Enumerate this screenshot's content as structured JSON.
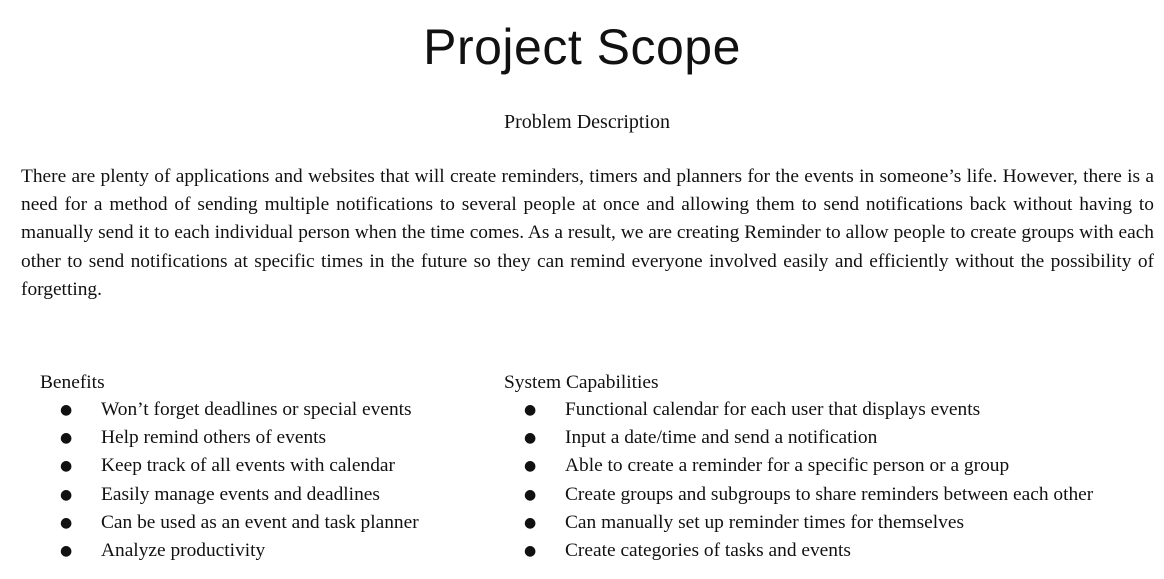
{
  "document": {
    "title": "Project Scope",
    "subtitle": "Problem Description",
    "paragraph": "There are plenty of applications and websites that will create reminders, timers and planners for the events in someone’s life. However, there is a need for a method of sending multiple notifications to several people at once and allowing them to send notifications back without having to manually send it to each individual person when the time comes. As a result, we are creating Reminder to allow people to create groups with each other to send notifications at specific times in the future so they can remind everyone involved easily and efficiently without the possibility of forgetting.",
    "benefits": {
      "heading": "Benefits",
      "items": [
        "Won’t forget deadlines or special events",
        "Help remind others of events",
        "Keep track of all events with calendar",
        "Easily manage events and deadlines",
        "Can be used as an event and task planner",
        "Analyze productivity"
      ]
    },
    "capabilities": {
      "heading": "System Capabilities",
      "items": [
        "Functional calendar for each user that displays events",
        "Input a date/time and send a notification",
        "Able to create a reminder for a specific person or a group",
        "Create groups and subgroups to share reminders between each other",
        "Can manually set up reminder times for themselves",
        "Create categories of tasks and events"
      ]
    },
    "bullet_glyph": "●"
  }
}
